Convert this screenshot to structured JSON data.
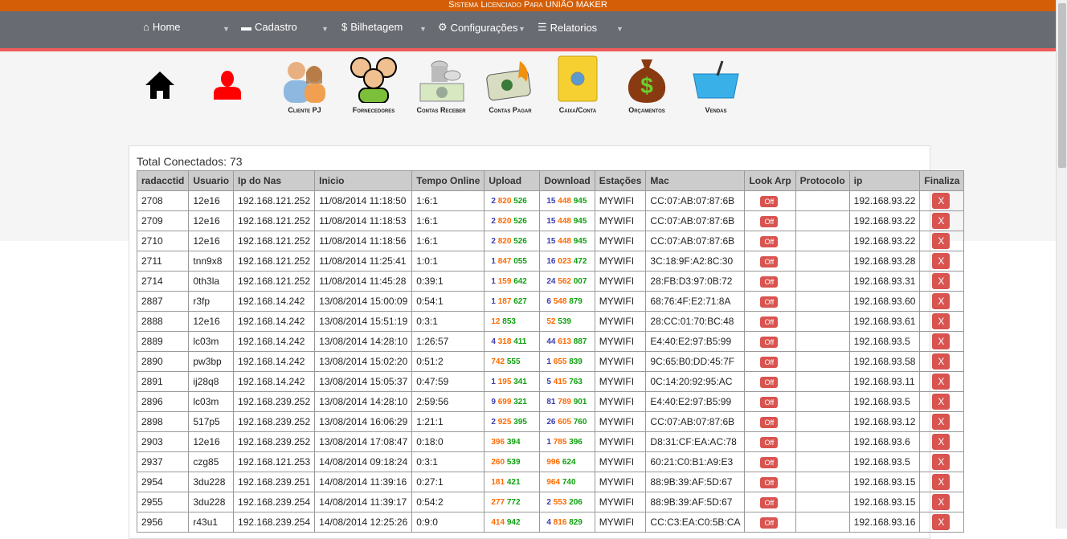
{
  "license": "Sistema Licenciado Para UNIÃO MAKER",
  "nav": [
    {
      "label": "Home",
      "icon": "home-icon",
      "glyph": "⌂"
    },
    {
      "label": "Cadastro",
      "icon": "card-icon",
      "glyph": "▬"
    },
    {
      "label": "Bilhetagem",
      "icon": "dollar-icon",
      "glyph": "$"
    },
    {
      "label": "Configurações",
      "icon": "gear-icon",
      "glyph": "⚙"
    },
    {
      "label": "Relatorios",
      "icon": "list-icon",
      "glyph": "☰"
    }
  ],
  "shortcuts": [
    {
      "label": "",
      "icon": "home-icon"
    },
    {
      "label": "",
      "icon": "user-icon"
    },
    {
      "label": "Cliente PJ",
      "icon": "clients-icon"
    },
    {
      "label": "Fornecedores",
      "icon": "suppliers-icon"
    },
    {
      "label": "Contas Receber",
      "icon": "money-coins-icon"
    },
    {
      "label": "Contas Pagar",
      "icon": "burning-money-icon"
    },
    {
      "label": "Caixa/Conta",
      "icon": "safe-icon"
    },
    {
      "label": "Orçamentos",
      "icon": "money-bag-icon"
    },
    {
      "label": "Vendas",
      "icon": "basket-icon"
    }
  ],
  "total_label": "Total Conectados: 73",
  "headers": [
    "radacctid",
    "Usuario",
    "Ip do Nas",
    "Inicio",
    "Tempo Online",
    "Upload",
    "Download",
    "Estações",
    "Mac",
    "Look Arp",
    "Protocolo",
    "ip",
    "Finaliza"
  ],
  "off_label": "Off",
  "finalize_label": "X",
  "colors": {
    "millions": "#3b3bb0",
    "thousands": "#ff6a00",
    "units": "#10a010",
    "button": "#d9534f"
  },
  "rows": [
    [
      "2708",
      "12e16",
      "192.168.121.252",
      "11/08/2014 11:18:50",
      "1:6:1",
      "2 820 526",
      "15 448 945",
      "MYWIFI",
      "CC:07:AB:07:87:6B",
      "",
      "192.168.93.22"
    ],
    [
      "2709",
      "12e16",
      "192.168.121.252",
      "11/08/2014 11:18:53",
      "1:6:1",
      "2 820 526",
      "15 448 945",
      "MYWIFI",
      "CC:07:AB:07:87:6B",
      "",
      "192.168.93.22"
    ],
    [
      "2710",
      "12e16",
      "192.168.121.252",
      "11/08/2014 11:18:56",
      "1:6:1",
      "2 820 526",
      "15 448 945",
      "MYWIFI",
      "CC:07:AB:07:87:6B",
      "",
      "192.168.93.22"
    ],
    [
      "2711",
      "tnn9x8",
      "192.168.121.252",
      "11/08/2014 11:25:41",
      "1:0:1",
      "1 847 055",
      "16 023 472",
      "MYWIFI",
      "3C:18:9F:A2:8C:30",
      "",
      "192.168.93.28"
    ],
    [
      "2714",
      "0th3la",
      "192.168.121.252",
      "11/08/2014 11:45:28",
      "0:39:1",
      "1 159 642",
      "24 562 007",
      "MYWIFI",
      "28:FB:D3:97:0B:72",
      "",
      "192.168.93.31"
    ],
    [
      "2887",
      "r3fp",
      "192.168.14.242",
      "13/08/2014 15:00:09",
      "0:54:1",
      "1 187 627",
      "6 548 879",
      "MYWIFI",
      "68:76:4F:E2:71:8A",
      "",
      "192.168.93.60"
    ],
    [
      "2888",
      "12e16",
      "192.168.14.242",
      "13/08/2014 15:51:19",
      "0:3:1",
      "12 853",
      "52 539",
      "MYWIFI",
      "28:CC:01:70:BC:48",
      "",
      "192.168.93.61"
    ],
    [
      "2889",
      "lc03m",
      "192.168.14.242",
      "13/08/2014 14:28:10",
      "1:26:57",
      "4 318 411",
      "44 613 887",
      "MYWIFI",
      "E4:40:E2:97:B5:99",
      "",
      "192.168.93.5"
    ],
    [
      "2890",
      "pw3bp",
      "192.168.14.242",
      "13/08/2014 15:02:20",
      "0:51:2",
      "742 555",
      "1 655 839",
      "MYWIFI",
      "9C:65:B0:DD:45:7F",
      "",
      "192.168.93.58"
    ],
    [
      "2891",
      "ij28q8",
      "192.168.14.242",
      "13/08/2014 15:05:37",
      "0:47:59",
      "1 195 341",
      "5 415 763",
      "MYWIFI",
      "0C:14:20:92:95:AC",
      "",
      "192.168.93.11"
    ],
    [
      "2896",
      "lc03m",
      "192.168.239.252",
      "13/08/2014 14:28:10",
      "2:59:56",
      "9 699 321",
      "81 789 901",
      "MYWIFI",
      "E4:40:E2:97:B5:99",
      "",
      "192.168.93.5"
    ],
    [
      "2898",
      "517p5",
      "192.168.239.252",
      "13/08/2014 16:06:29",
      "1:21:1",
      "2 925 395",
      "26 605 760",
      "MYWIFI",
      "CC:07:AB:07:87:6B",
      "",
      "192.168.93.12"
    ],
    [
      "2903",
      "12e16",
      "192.168.239.252",
      "13/08/2014 17:08:47",
      "0:18:0",
      "396 394",
      "1 785 396",
      "MYWIFI",
      "D8:31:CF:EA:AC:78",
      "",
      "192.168.93.6"
    ],
    [
      "2937",
      "czg85",
      "192.168.121.253",
      "14/08/2014 09:18:24",
      "0:3:1",
      "260 539",
      "996 624",
      "MYWIFI",
      "60:21:C0:B1:A9:E3",
      "",
      "192.168.93.5"
    ],
    [
      "2954",
      "3du228",
      "192.168.239.251",
      "14/08/2014 11:39:16",
      "0:27:1",
      "181 421",
      "964 740",
      "MYWIFI",
      "88:9B:39:AF:5D:67",
      "",
      "192.168.93.15"
    ],
    [
      "2955",
      "3du228",
      "192.168.239.254",
      "14/08/2014 11:39:17",
      "0:54:2",
      "277 772",
      "2 553 206",
      "MYWIFI",
      "88:9B:39:AF:5D:67",
      "",
      "192.168.93.15"
    ],
    [
      "2956",
      "r43u1",
      "192.168.239.254",
      "14/08/2014 12:25:26",
      "0:9:0",
      "414 942",
      "4 816 829",
      "MYWIFI",
      "CC:C3:EA:C0:5B:CA",
      "",
      "192.168.93.16"
    ]
  ]
}
